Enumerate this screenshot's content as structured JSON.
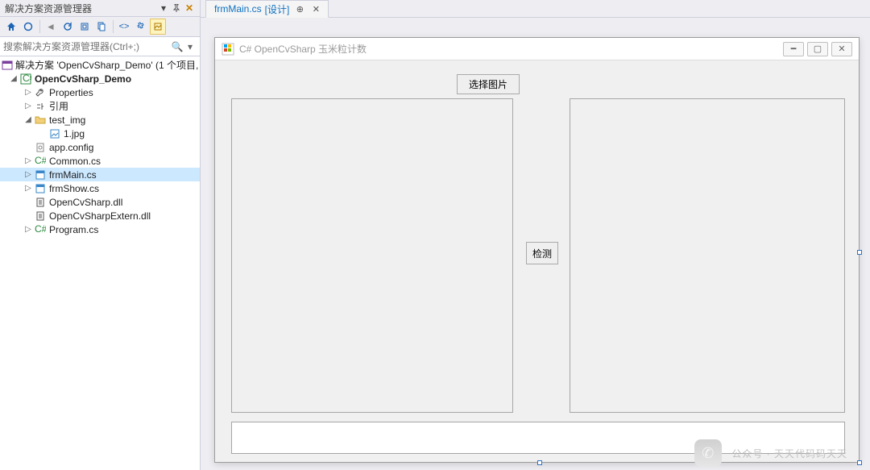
{
  "solution_explorer": {
    "title": "解决方案资源管理器",
    "search_placeholder": "搜索解决方案资源管理器(Ctrl+;)",
    "solution_label": "解决方案 'OpenCvSharp_Demo' (1 个项目, 共 1",
    "project_label": "OpenCvSharp_Demo",
    "nodes": {
      "properties": "Properties",
      "references": "引用",
      "test_img": "test_img",
      "file_1jpg": "1.jpg",
      "app_config": "app.config",
      "common_cs": "Common.cs",
      "frmMain_cs": "frmMain.cs",
      "frmShow_cs": "frmShow.cs",
      "opencvsharp_dll": "OpenCvSharp.dll",
      "opencvsharpextern_dll": "OpenCvSharpExtern.dll",
      "program_cs": "Program.cs"
    }
  },
  "tab": {
    "file": "frmMain.cs",
    "mode": "[设计]"
  },
  "form": {
    "caption": "C# OpenCvSharp 玉米粒计数",
    "btn_select_image": "选择图片",
    "btn_detect": "检测"
  },
  "watermark": "公众号 · 天天代码码天天",
  "colors": {
    "accent": "#0e70c0",
    "panel_bg": "#eeeef2"
  }
}
